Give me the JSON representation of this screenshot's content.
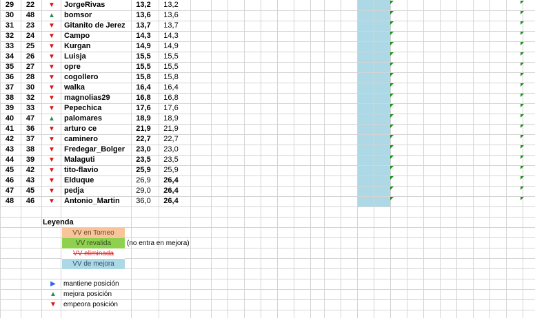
{
  "rows": [
    {
      "rank": "29",
      "prev": "22",
      "trend": "down",
      "name": "JorgeRivas",
      "a": "13,2",
      "b": "13,2",
      "a_bold": true,
      "b_bold": false
    },
    {
      "rank": "30",
      "prev": "48",
      "trend": "up",
      "name": "bomsor",
      "a": "13,6",
      "b": "13,6",
      "a_bold": true,
      "b_bold": false
    },
    {
      "rank": "31",
      "prev": "23",
      "trend": "down",
      "name": "Gitanito de Jerez",
      "a": "13,7",
      "b": "13,7",
      "a_bold": true,
      "b_bold": false
    },
    {
      "rank": "32",
      "prev": "24",
      "trend": "down",
      "name": "Campo",
      "a": "14,3",
      "b": "14,3",
      "a_bold": true,
      "b_bold": false
    },
    {
      "rank": "33",
      "prev": "25",
      "trend": "down",
      "name": "Kurgan",
      "a": "14,9",
      "b": "14,9",
      "a_bold": true,
      "b_bold": false
    },
    {
      "rank": "34",
      "prev": "26",
      "trend": "down",
      "name": "Luisja",
      "a": "15,5",
      "b": "15,5",
      "a_bold": true,
      "b_bold": false
    },
    {
      "rank": "35",
      "prev": "27",
      "trend": "down",
      "name": "opre",
      "a": "15,5",
      "b": "15,5",
      "a_bold": true,
      "b_bold": false
    },
    {
      "rank": "36",
      "prev": "28",
      "trend": "down",
      "name": "cogollero",
      "a": "15,8",
      "b": "15,8",
      "a_bold": true,
      "b_bold": false
    },
    {
      "rank": "37",
      "prev": "30",
      "trend": "down",
      "name": "walka",
      "a": "16,4",
      "b": "16,4",
      "a_bold": true,
      "b_bold": false
    },
    {
      "rank": "38",
      "prev": "32",
      "trend": "down",
      "name": "magnolias29",
      "a": "16,8",
      "b": "16,8",
      "a_bold": true,
      "b_bold": false
    },
    {
      "rank": "39",
      "prev": "33",
      "trend": "down",
      "name": "Pepechica",
      "a": "17,6",
      "b": "17,6",
      "a_bold": true,
      "b_bold": false
    },
    {
      "rank": "40",
      "prev": "47",
      "trend": "up",
      "name": "palomares",
      "a": "18,9",
      "b": "18,9",
      "a_bold": true,
      "b_bold": false
    },
    {
      "rank": "41",
      "prev": "36",
      "trend": "down",
      "name": "arturo ce",
      "a": "21,9",
      "b": "21,9",
      "a_bold": true,
      "b_bold": false
    },
    {
      "rank": "42",
      "prev": "37",
      "trend": "down",
      "name": "caminero",
      "a": "22,7",
      "b": "22,7",
      "a_bold": true,
      "b_bold": false
    },
    {
      "rank": "43",
      "prev": "38",
      "trend": "down",
      "name": "Fredegar_Bolger",
      "a": "23,0",
      "b": "23,0",
      "a_bold": true,
      "b_bold": false
    },
    {
      "rank": "44",
      "prev": "39",
      "trend": "down",
      "name": "Malaguti",
      "a": "23,5",
      "b": "23,5",
      "a_bold": true,
      "b_bold": false
    },
    {
      "rank": "45",
      "prev": "42",
      "trend": "down",
      "name": "tito-flavio",
      "a": "25,9",
      "b": "25,9",
      "a_bold": true,
      "b_bold": false
    },
    {
      "rank": "46",
      "prev": "43",
      "trend": "down",
      "name": "Elduque",
      "a": "26,9",
      "b": "26,4",
      "a_bold": false,
      "b_bold": true
    },
    {
      "rank": "47",
      "prev": "45",
      "trend": "down",
      "name": "pedja",
      "a": "29,0",
      "b": "26,4",
      "a_bold": false,
      "b_bold": true
    },
    {
      "rank": "48",
      "prev": "46",
      "trend": "down",
      "name": "Antonio_Martin",
      "a": "36,0",
      "b": "26,4",
      "a_bold": false,
      "b_bold": true
    }
  ],
  "trend_icons": {
    "down": "triangle-down-icon",
    "up": "triangle-up-icon",
    "same": "triangle-right-icon"
  },
  "colors": {
    "down": "#dd1111",
    "up": "#2e8b57",
    "same": "#3366ee",
    "vv_torneo": "#f8c49a",
    "vv_revalida": "#8fd14f",
    "vv_mejora": "#add8e6",
    "flag": "#1a8f1a"
  },
  "legend": {
    "title": "Leyenda",
    "vv_torneo": "VV en Torneo",
    "vv_revalida": "VV revalida",
    "vv_revalida_note": "(no entra en mejora)",
    "vv_eliminada": "VV eliminada",
    "vv_mejora": "VV de mejora",
    "mantiene": "mantiene posición",
    "mejora": "mejora posición",
    "empeora": "empeora posición"
  }
}
